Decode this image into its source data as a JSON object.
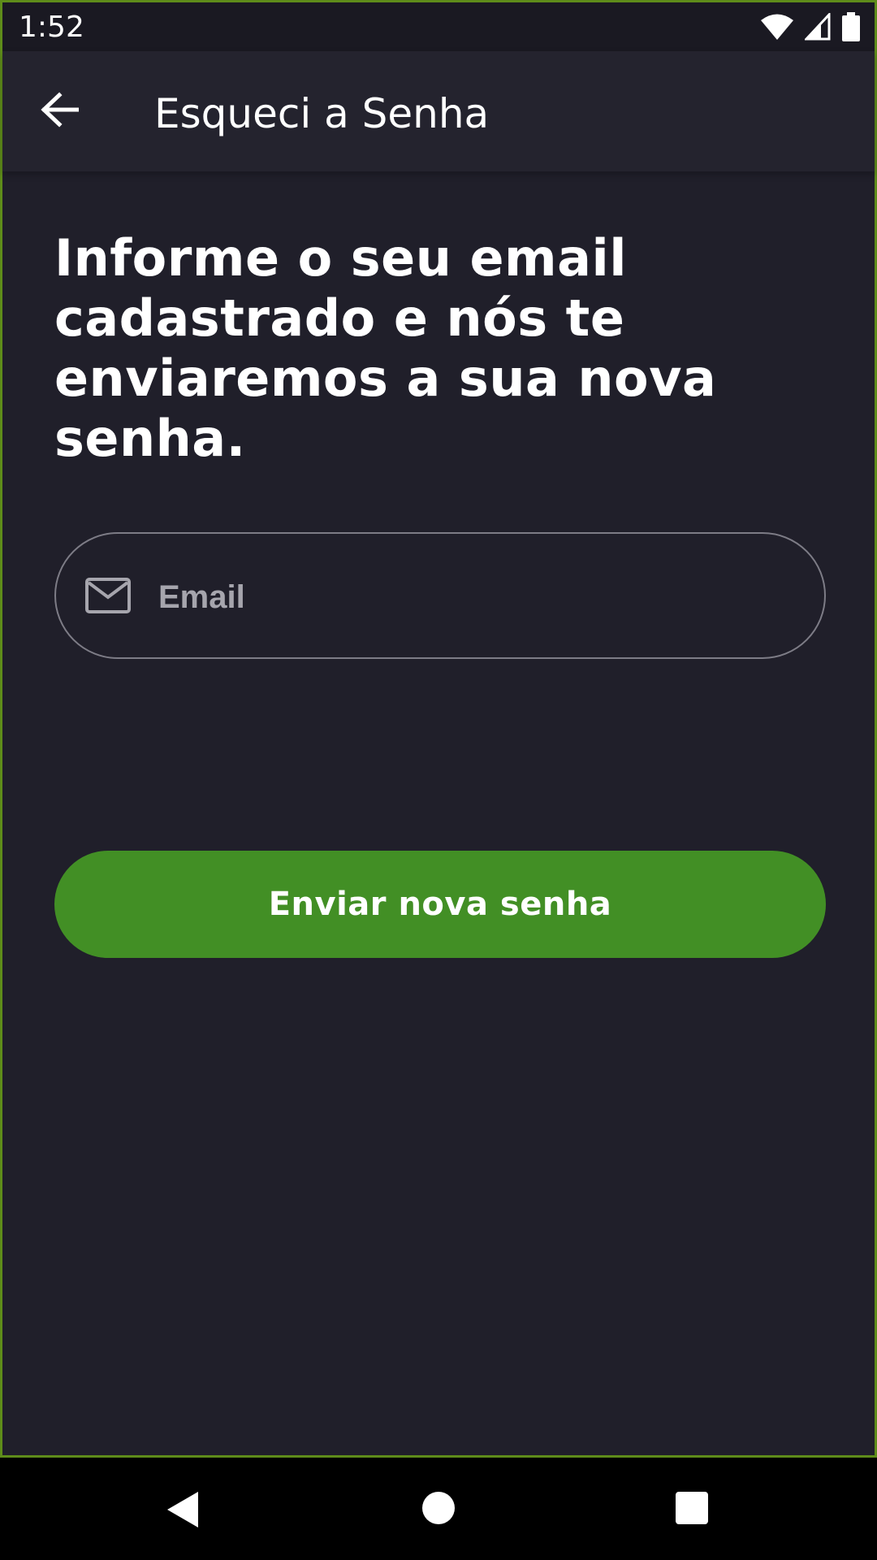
{
  "status_bar": {
    "time": "1:52",
    "icons": [
      "wifi-icon",
      "cell-signal-icon",
      "battery-icon"
    ]
  },
  "app_bar": {
    "title": "Esqueci a Senha",
    "back_icon": "arrow-left-icon"
  },
  "main": {
    "headline": "Informe o seu email cadastrado e nós te enviaremos a sua nova senha.",
    "email_field": {
      "placeholder": "Email",
      "value": "",
      "icon": "mail-icon"
    },
    "submit_label": "Enviar nova senha"
  },
  "nav_bar": {
    "icons": [
      "back-triangle-icon",
      "home-circle-icon",
      "recents-square-icon"
    ]
  },
  "colors": {
    "background": "#201f2a",
    "app_bar": "#24232e",
    "accent_green": "#428f25",
    "field_border": "#7d7c86",
    "placeholder": "#a6a5ad"
  }
}
